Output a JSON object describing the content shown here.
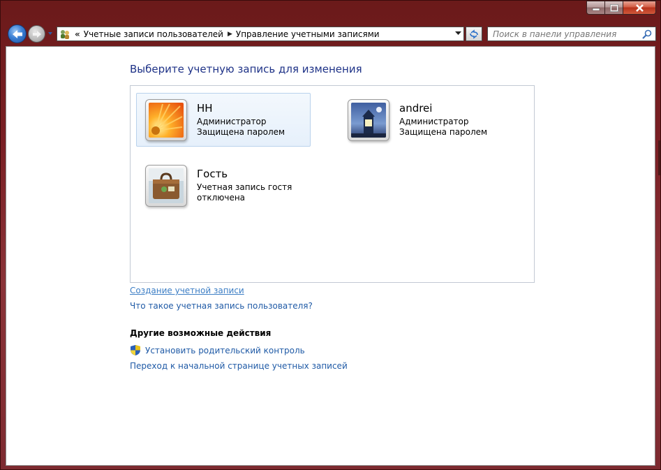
{
  "window": {
    "controls": {
      "minimize_icon": "minimize-icon",
      "maximize_icon": "maximize-icon",
      "close_icon": "close-icon"
    }
  },
  "navbar": {
    "back_icon": "back-arrow-icon",
    "forward_icon": "forward-arrow-icon",
    "address": {
      "overflow": "«",
      "crumbs": [
        "Учетные записи пользователей",
        "Управление учетными записями"
      ]
    },
    "search": {
      "placeholder": "Поиск в панели управления"
    }
  },
  "main": {
    "heading": "Выберите учетную запись для изменения",
    "accounts": [
      {
        "name": "НН",
        "lines": [
          "Администратор",
          "Защищена паролем"
        ],
        "avatar": "flower-avatar",
        "selected": true
      },
      {
        "name": "andrei",
        "lines": [
          "Администратор",
          "Защищена паролем"
        ],
        "avatar": "lighthouse-avatar",
        "selected": false
      },
      {
        "name": "Гость",
        "lines": [
          "Учетная запись гостя отключена"
        ],
        "avatar": "suitcase-avatar",
        "selected": false
      }
    ],
    "links": {
      "create_account": "Создание учетной записи",
      "what_is_account": "Что такое учетная запись пользователя?"
    },
    "other_actions": {
      "title": "Другие возможные действия",
      "parental_control": "Установить родительский контроль",
      "accounts_home": "Переход к начальной странице учетных записей"
    }
  },
  "colors": {
    "frame": "#7a1f24",
    "heading": "#1e3287",
    "link": "#1f5aa6",
    "selected_bg": "#e6f0fb"
  }
}
